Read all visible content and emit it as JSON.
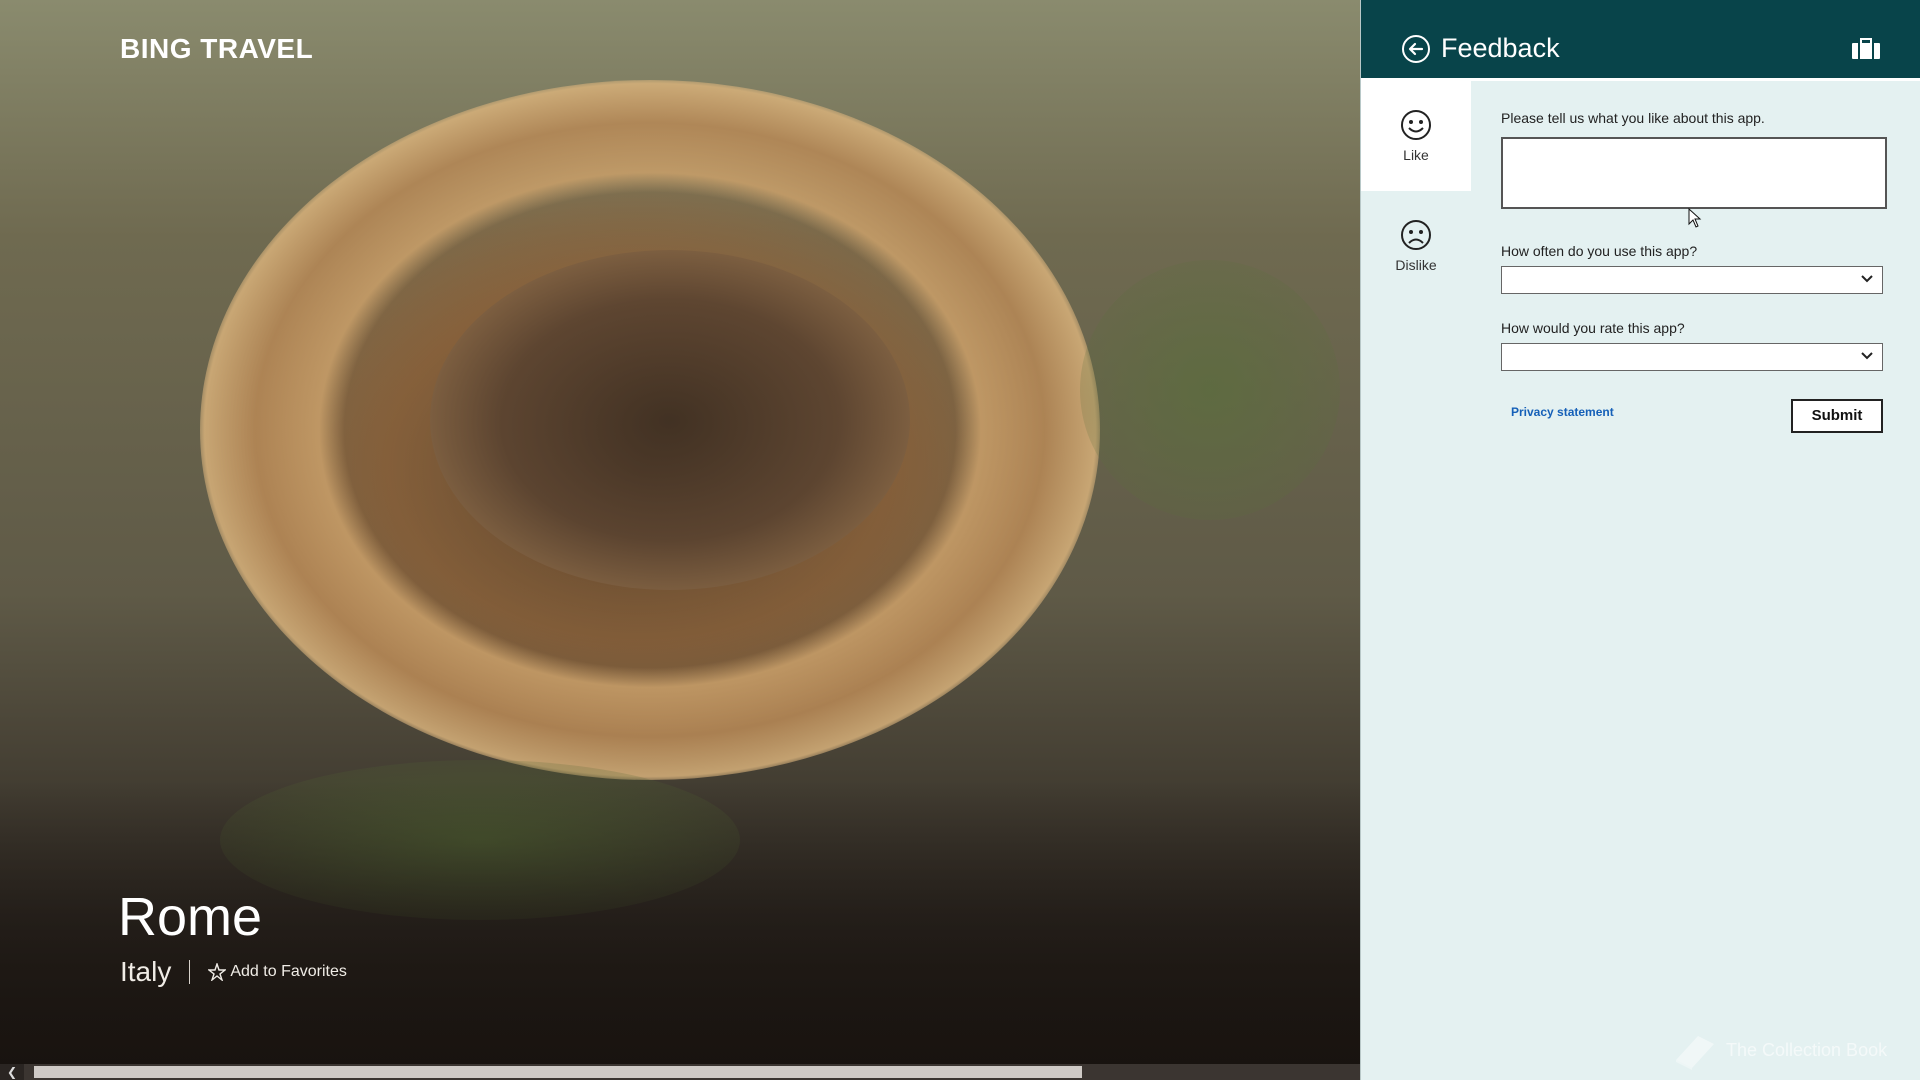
{
  "app": {
    "title": "BING TRAVEL"
  },
  "destination": {
    "city": "Rome",
    "country": "Italy",
    "favorite_label": "Add to Favorites"
  },
  "feedback_pane": {
    "title": "Feedback",
    "tabs": [
      {
        "label": "Like",
        "icon": "smile-icon",
        "active": true
      },
      {
        "label": "Dislike",
        "icon": "frown-icon",
        "active": false
      }
    ],
    "questions": {
      "like_prompt": "Please tell us what you like about this app.",
      "like_value": "",
      "frequency_prompt": "How often do you use this app?",
      "frequency_value": "",
      "rating_prompt": "How would you rate this app?",
      "rating_value": ""
    },
    "privacy_label": "Privacy statement",
    "submit_label": "Submit"
  },
  "watermark": {
    "text": "The Collection Book"
  },
  "colors": {
    "pane_header": "#08444a",
    "pane_background": "#e4f1f1",
    "privacy_link": "#1560b8"
  }
}
